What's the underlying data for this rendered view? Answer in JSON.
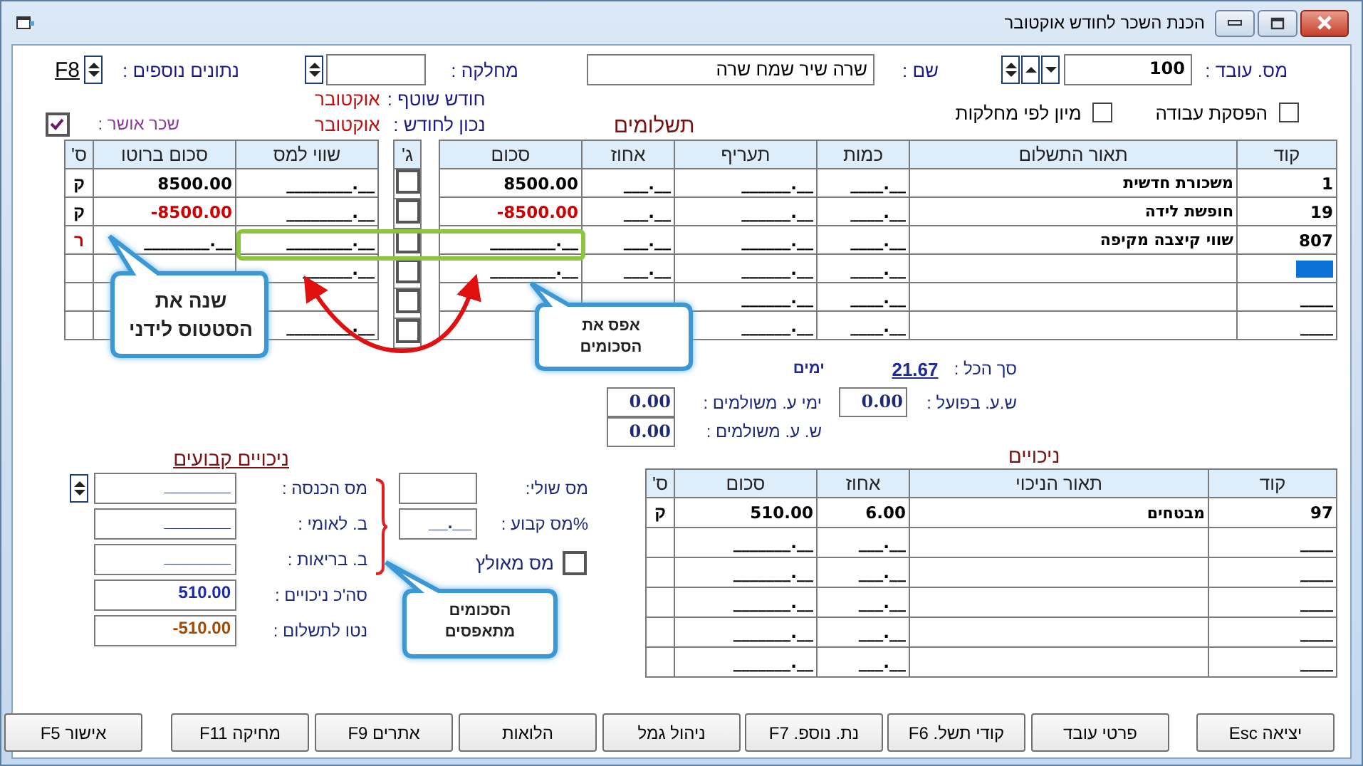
{
  "window": {
    "title": "הכנת השכר לחודש אוקטובר"
  },
  "header": {
    "employee_no_label": "מס. עובד :",
    "employee_no": "100",
    "name_label": "שם :",
    "name": "שרה שיר שמח שרה",
    "department_label": "מחלקה :",
    "extra_data_label": "נתונים נוספים :",
    "extra_data_key": "F8",
    "current_month_label": "חודש שוטף :",
    "current_month": "אוקטובר",
    "as_of_month_label": "נכון לחודש :",
    "as_of_month": "אוקטובר",
    "approved_label": "שכר אושר :",
    "approved": true
  },
  "options": [
    {
      "label": "הפסקת עבודה",
      "checked": false
    },
    {
      "label": "מיון לפי מחלקות",
      "checked": false
    }
  ],
  "payments": {
    "title": "תשלומים",
    "columns": [
      "קוד",
      "תאור התשלום",
      "כמות",
      "תעריף",
      "אחוז",
      "סכום"
    ],
    "exempt_column": "ג'",
    "side_columns": [
      "שווי למס",
      "סכום ברוטו",
      "ס'"
    ],
    "rows": [
      {
        "code": "1",
        "description": "משכורת חדשית",
        "quantity": "____.__",
        "rate": "______.__",
        "percent": "___.__",
        "amount": "8500.00",
        "exempt": false,
        "taxable": "________.__",
        "gross": "8500.00",
        "status": "ק",
        "color": "#000000",
        "negative": false,
        "selected": false
      },
      {
        "code": "19",
        "description": "חופשת לידה",
        "quantity": "____.__",
        "rate": "______.__",
        "percent": "___.__",
        "amount": "-8500.00",
        "exempt": false,
        "taxable": "________.__",
        "gross": "-8500.00",
        "status": "ק",
        "color": "#000000",
        "negative": true,
        "selected": false
      },
      {
        "code": "807",
        "description": "שווי קיצבה מקיפה",
        "quantity": "____.__",
        "rate": "______.__",
        "percent": "___.__",
        "amount": "________.__",
        "exempt": false,
        "taxable": "________.__",
        "gross": "________.__",
        "status": "ר",
        "color": "#c00000",
        "negative": false,
        "selected": false
      },
      {
        "quantity": "____.__",
        "rate": "______.__",
        "percent": "___.__",
        "amount": "________.__",
        "exempt": false,
        "taxable": "______.__",
        "negative": false,
        "selected": true
      },
      {
        "code": "____",
        "quantity": "____.__",
        "rate": "______.__",
        "exempt": false,
        "selected": false
      },
      {
        "code": "____",
        "quantity": "____.__",
        "rate": "______.__",
        "exempt": false,
        "taxable": "________.__",
        "selected": false
      }
    ]
  },
  "totals": {
    "total_label": "סך הכל :",
    "total_days": "21.67",
    "days_label": "ימים",
    "actual_hours_label": "ש.ע. בפועל :",
    "actual_hours": "0.00",
    "paid_days_label": "ימי ע. משולמים :",
    "paid_days": "0.00",
    "paid_hours_label": "ש. ע. משולמים :",
    "paid_hours": "0.00"
  },
  "deductions": {
    "title": "ניכויים",
    "columns": [
      "קוד",
      "תאור הניכוי",
      "אחוז",
      "סכום",
      "ס'"
    ],
    "rows": [
      {
        "code": "97",
        "description": "מבטחים",
        "percent": "6.00",
        "amount": "510.00",
        "status": "ק"
      },
      {
        "code": "____",
        "percent": "___.__",
        "amount": "_______.__"
      },
      {
        "code": "____",
        "percent": "___.__",
        "amount": "_______.__"
      },
      {
        "code": "____",
        "percent": "___.__",
        "amount": "_______.__"
      },
      {
        "code": "____",
        "percent": "___.__",
        "amount": "_______.__"
      },
      {
        "code": "____",
        "percent": "___.__",
        "amount": "_______.__"
      }
    ]
  },
  "tax": {
    "marginal_label": "מס שולי:",
    "fixed_label": "%מס קבוע :",
    "fixed_value": "__.__",
    "forced_label": "מס מאולץ",
    "forced": false
  },
  "fixed_deductions": {
    "title": "ניכויים קבועים",
    "items": [
      {
        "label": "מס הכנסה :",
        "value": "_______",
        "kind": "entry"
      },
      {
        "label": "ב. לאומי :",
        "value": "_______",
        "kind": "entry"
      },
      {
        "label": "ב. בריאות :",
        "value": "_______",
        "kind": "entry"
      },
      {
        "label": "סה'כ ניכויים :",
        "value": "510.00",
        "kind": "total"
      },
      {
        "label": "נטו לתשלום :",
        "value": "-510.00",
        "kind": "net"
      }
    ]
  },
  "callouts": [
    {
      "text": "אפס את הסכומים"
    },
    {
      "text": "שנה את הסטטוס לידני"
    },
    {
      "text": "הסכומים מתאפסים"
    }
  ],
  "buttons": [
    "יציאה Esc",
    "פרטי עובד",
    "קודי תשל. F6",
    "נת. נוספ. F7",
    "ניהול גמל",
    "הלואות",
    "אתרים F9",
    "מחיקה F11",
    "אישור F5"
  ]
}
